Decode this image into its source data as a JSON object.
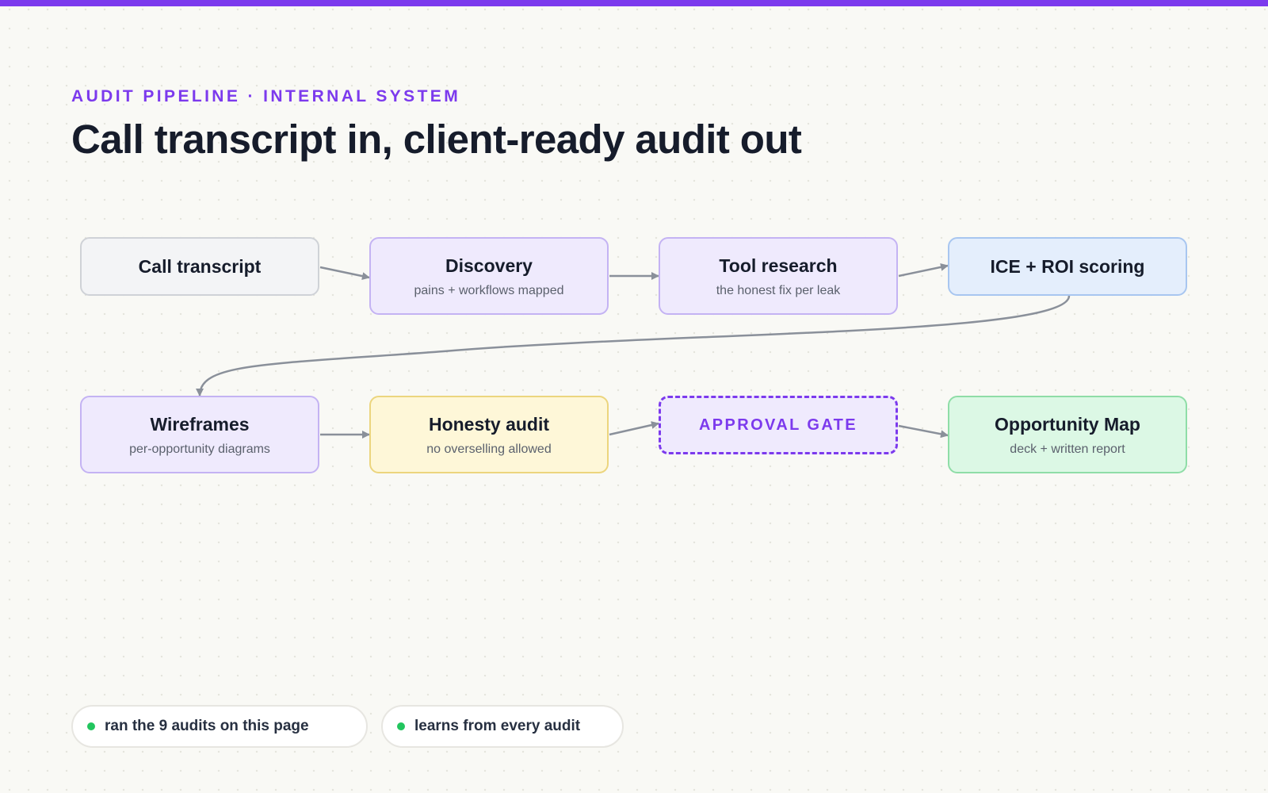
{
  "header": {
    "eyebrow": "AUDIT PIPELINE · INTERNAL SYSTEM",
    "title": "Call transcript in, client-ready audit out"
  },
  "colors": {
    "accent": "#7c3aed",
    "arrow": "#8a909a",
    "status_dot": "#22c55e"
  },
  "pipeline": {
    "nodes": [
      {
        "title": "Call transcript",
        "subtitle": ""
      },
      {
        "title": "Discovery",
        "subtitle": "pains + workflows mapped"
      },
      {
        "title": "Tool research",
        "subtitle": "the honest fix per leak"
      },
      {
        "title": "ICE + ROI scoring",
        "subtitle": ""
      },
      {
        "title": "Wireframes",
        "subtitle": "per-opportunity diagrams"
      },
      {
        "title": "Honesty audit",
        "subtitle": "no overselling allowed"
      },
      {
        "title": "APPROVAL GATE",
        "subtitle": ""
      },
      {
        "title": "Opportunity Map",
        "subtitle": "deck + written report"
      }
    ]
  },
  "footer": {
    "chips": [
      {
        "label": "ran the 9 audits on this page"
      },
      {
        "label": "learns from every audit"
      }
    ]
  }
}
